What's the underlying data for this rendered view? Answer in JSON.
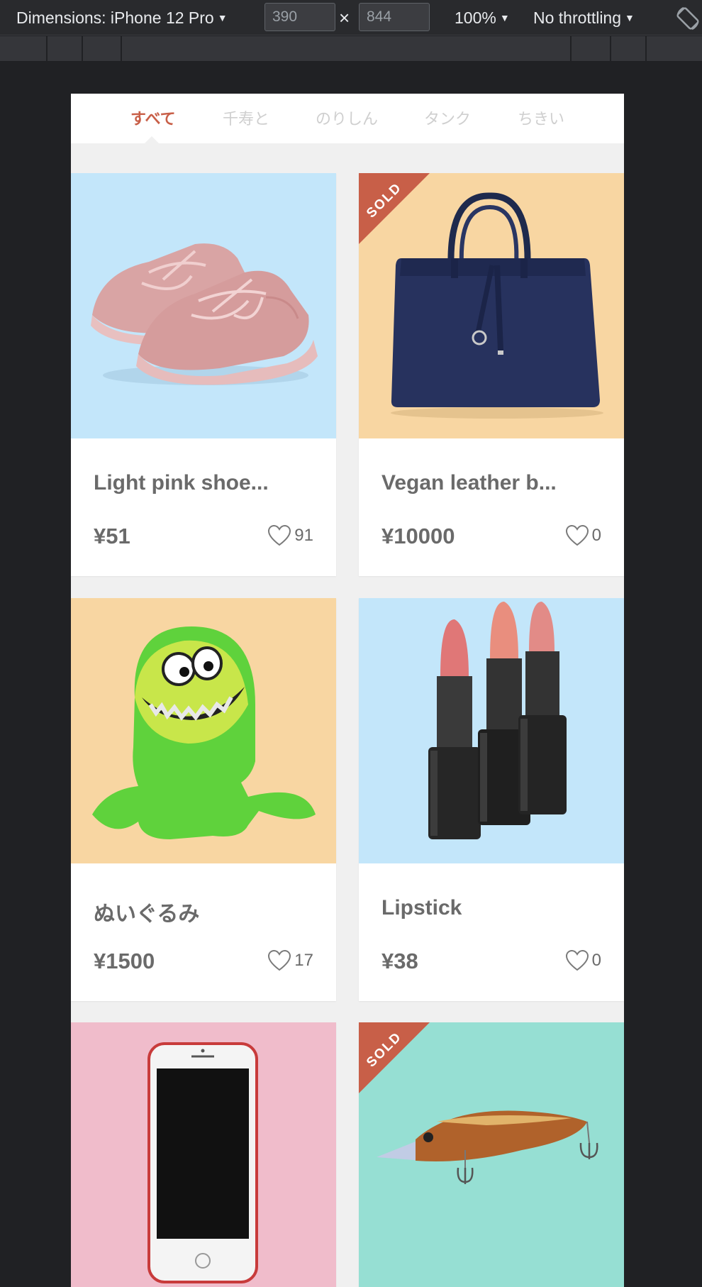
{
  "devtools": {
    "dimensions_label": "Dimensions: iPhone 12 Pro",
    "width_value": "390",
    "height_value": "844",
    "times": "×",
    "zoom": "100%",
    "throttling": "No throttling",
    "caret": "▼"
  },
  "tabs": [
    {
      "label": "すべて",
      "active": true
    },
    {
      "label": "千寿と",
      "active": false
    },
    {
      "label": "のりしん",
      "active": false
    },
    {
      "label": "タンク",
      "active": false
    },
    {
      "label": "ちきい",
      "active": false
    }
  ],
  "products": [
    {
      "title": "Light pink shoe...",
      "price": "¥51",
      "likes": "91",
      "sold": false,
      "bg": "#c3e6fa",
      "image": "pink-sneakers"
    },
    {
      "title": "Vegan leather b...",
      "price": "¥10000",
      "likes": "0",
      "sold": true,
      "sold_label": "SOLD",
      "bg": "#f8d6a2",
      "image": "navy-handbag"
    },
    {
      "title": "ぬいぐるみ",
      "price": "¥1500",
      "likes": "17",
      "sold": false,
      "bg": "#f8d6a2",
      "image": "green-plush-monster"
    },
    {
      "title": "Lipstick",
      "price": "¥38",
      "likes": "0",
      "sold": false,
      "bg": "#c3e6fa",
      "image": "lipsticks"
    },
    {
      "title": "",
      "price": "",
      "likes": "",
      "sold": false,
      "bg": "#f0bccb",
      "image": "smartphone"
    },
    {
      "title": "",
      "price": "",
      "likes": "",
      "sold": true,
      "sold_label": "SOLD",
      "bg": "#96dfd3",
      "image": "fishing-lure"
    }
  ],
  "colors": {
    "accent": "#c85f48",
    "tab_inactive": "#cfcfcf",
    "text": "#6a6a6a",
    "devtools_bg": "#202124"
  }
}
